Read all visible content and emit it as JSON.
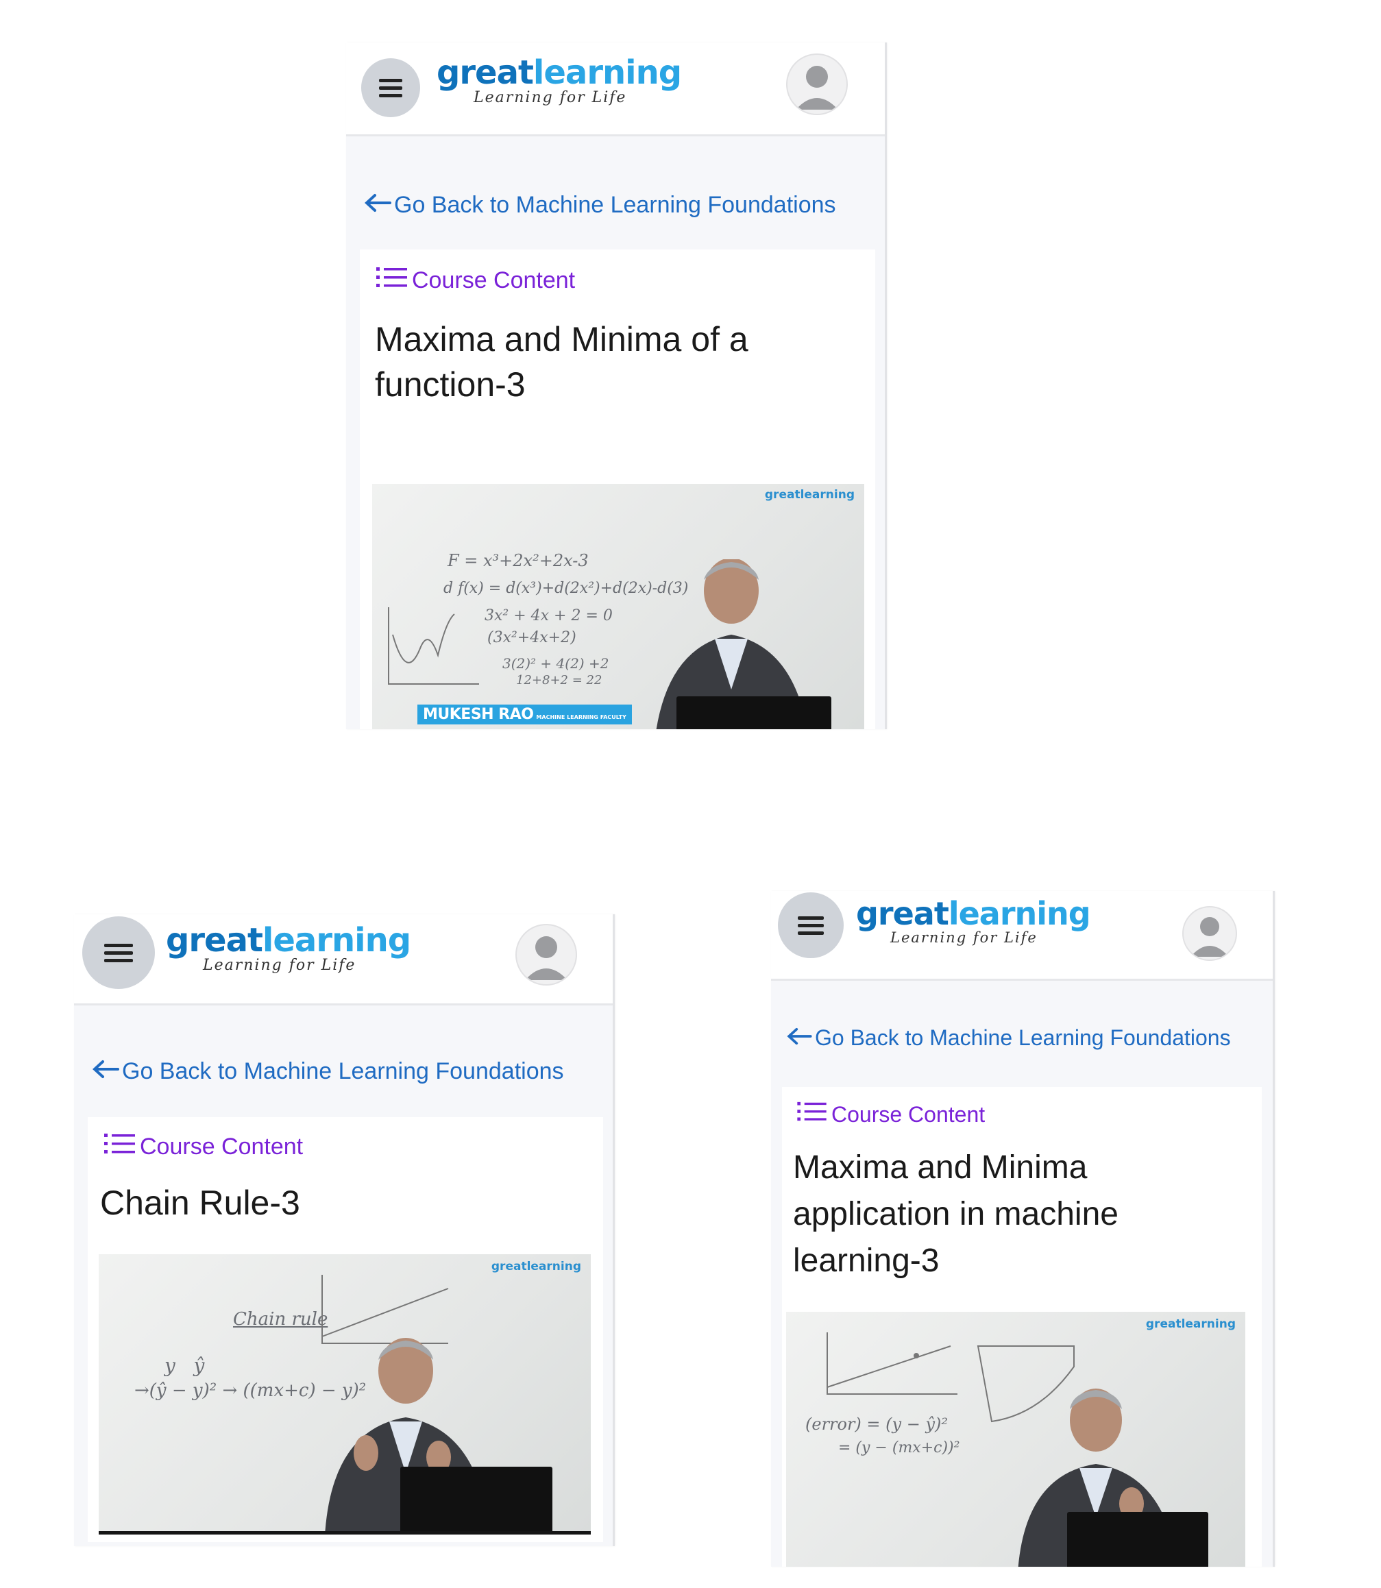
{
  "brand": {
    "logo_main": "great",
    "logo_accent": "learning",
    "tagline": "Learning for Life"
  },
  "icons": {
    "menu": "hamburger-icon",
    "profile": "avatar-icon",
    "back": "arrow-left-icon",
    "course_content": "list-icon"
  },
  "colors": {
    "brand_blue": "#0f72bb",
    "link_blue": "#1f6bc2",
    "course_content_purple": "#7a22d8"
  },
  "screens": [
    {
      "back_link": "Go Back to Machine Learning Foundations",
      "course_content": "Course Content",
      "lesson_title": "Maxima and Minima of a function-3",
      "video": {
        "watermark": "greatlearning",
        "instructor_name": "MUKESH RAO",
        "instructor_role": "MACHINE LEARNING FACULTY",
        "instructor_org": "greatlearning"
      }
    },
    {
      "back_link": "Go Back to Machine Learning Foundations",
      "course_content": "Course Content",
      "lesson_title": "Chain Rule-3",
      "video": {
        "watermark": "greatlearning"
      }
    },
    {
      "back_link": "Go Back to Machine Learning Foundations",
      "course_content": "Course Content",
      "lesson_title": "Maxima and Minima application in machine learning-3",
      "video": {
        "watermark": "greatlearning"
      }
    }
  ]
}
